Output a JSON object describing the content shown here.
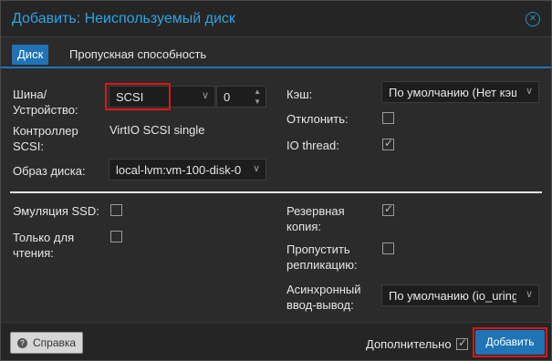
{
  "window": {
    "title": "Добавить: Неиспользуемый диск"
  },
  "tabs": [
    {
      "label": "Диск",
      "active": true
    },
    {
      "label": "Пропускная способность",
      "active": false
    }
  ],
  "left": {
    "bus_label": "Шина/\nУстройство:",
    "bus_value": "SCSI",
    "device_number": "0",
    "controller_label": "Контроллер\nSCSI:",
    "controller_value": "VirtIO SCSI single",
    "image_label": "Образ диска:",
    "image_value": "local-lvm:vm-100-disk-0"
  },
  "right": {
    "cache_label": "Кэш:",
    "cache_value": "По умолчанию (Нет кэша)",
    "discard_label": "Отклонить:",
    "discard_checked": false,
    "iothread_label": "IO thread:",
    "iothread_checked": true
  },
  "advanced": {
    "ssd_label": "Эмуляция SSD:",
    "ssd_checked": false,
    "readonly_label": "Только для\nчтения:",
    "readonly_checked": false,
    "backup_label": "Резервная\nкопия:",
    "backup_checked": true,
    "skip_repl_label": "Пропустить\nрепликацию:",
    "skip_repl_checked": false,
    "async_io_label": "Асинхронный\nввод-вывод:",
    "async_io_value": "По умолчанию (io_uring)"
  },
  "footer": {
    "help_label": "Справка",
    "advanced_label": "Дополнительно",
    "advanced_checked": true,
    "add_label": "Добавить"
  },
  "colors": {
    "accent": "#1f74b6",
    "title": "#2ea4e6",
    "highlight": "#e01414"
  }
}
